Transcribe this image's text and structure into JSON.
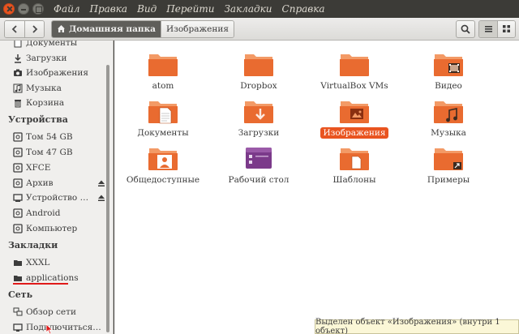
{
  "menubar": {
    "items": [
      "Файл",
      "Правка",
      "Вид",
      "Перейти",
      "Закладки",
      "Справка"
    ]
  },
  "toolbar": {
    "back_icon": "chevron-left-icon",
    "forward_icon": "chevron-right-icon",
    "path": [
      {
        "label": "Домашняя папка",
        "icon": "home-icon"
      },
      {
        "label": "Изображения"
      }
    ],
    "search_icon": "search-icon",
    "list_view_icon": "list-icon",
    "grid_view_icon": "grid-icon"
  },
  "sidebar": {
    "places": [
      {
        "label": "Документы",
        "icon": "document-icon"
      },
      {
        "label": "Загрузки",
        "icon": "download-icon"
      },
      {
        "label": "Изображения",
        "icon": "camera-icon"
      },
      {
        "label": "Музыка",
        "icon": "music-icon"
      },
      {
        "label": "Корзина",
        "icon": "trash-icon"
      }
    ],
    "devices_header": "Устройства",
    "devices": [
      {
        "label": "Том 54 GB",
        "icon": "drive-icon"
      },
      {
        "label": "Том 47 GB",
        "icon": "drive-icon"
      },
      {
        "label": "XFCE",
        "icon": "drive-icon"
      },
      {
        "label": "Архив",
        "icon": "drive-icon",
        "eject": true
      },
      {
        "label": "Устройство …",
        "icon": "device-icon",
        "eject": true
      },
      {
        "label": "Android",
        "icon": "drive-icon"
      },
      {
        "label": "Компьютер",
        "icon": "drive-icon"
      }
    ],
    "bookmarks_header": "Закладки",
    "bookmarks": [
      {
        "label": "XXXL",
        "icon": "folder-icon"
      },
      {
        "label": "applications",
        "icon": "folder-icon"
      }
    ],
    "network_header": "Сеть",
    "network": [
      {
        "label": "Обзор сети",
        "icon": "network-icon"
      },
      {
        "label": "Подключиться…",
        "icon": "connect-icon"
      }
    ]
  },
  "files": [
    {
      "name": "atom",
      "emblem": ""
    },
    {
      "name": "Dropbox",
      "emblem": ""
    },
    {
      "name": "VirtualBox VMs",
      "emblem": ""
    },
    {
      "name": "Видео",
      "emblem": "film"
    },
    {
      "name": "Документы",
      "emblem": "document"
    },
    {
      "name": "Загрузки",
      "emblem": "download"
    },
    {
      "name": "Изображения",
      "emblem": "picture",
      "selected": true
    },
    {
      "name": "Музыка",
      "emblem": "music"
    },
    {
      "name": "Общедоступные",
      "emblem": "person"
    },
    {
      "name": "Рабочий стол",
      "emblem": "desktop"
    },
    {
      "name": "Шаблоны",
      "emblem": "template"
    },
    {
      "name": "Примеры",
      "emblem": "link"
    }
  ],
  "status": "Выделен объект «Изображения» (внутри 1 объект)",
  "colors": {
    "folder": "#e96b30",
    "folder_tab": "#f39a66",
    "accent": "#e95420",
    "desktop": "#7b3a8a"
  }
}
